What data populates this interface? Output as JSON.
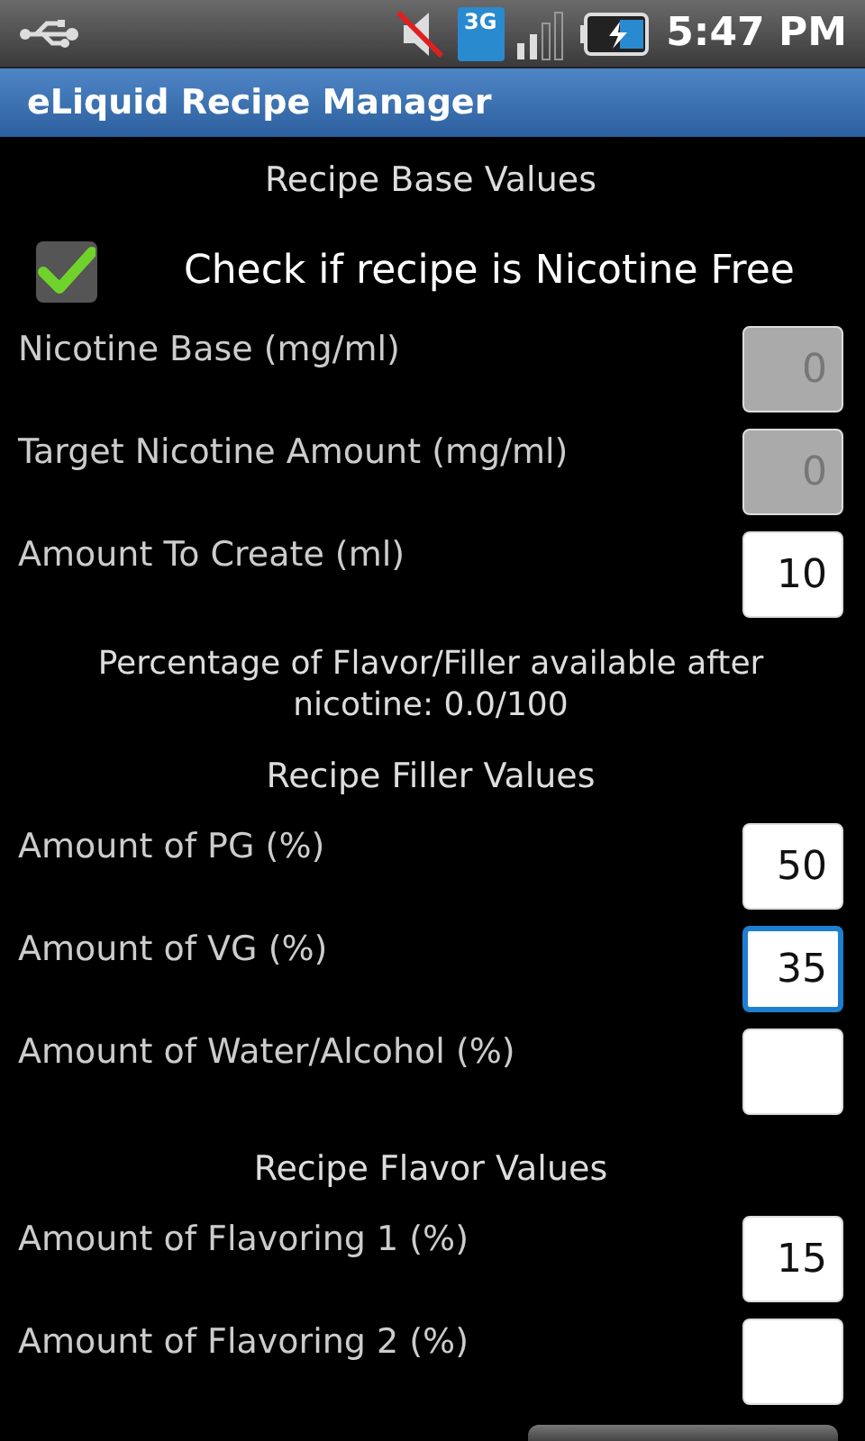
{
  "status_bar": {
    "network": "3G",
    "time": "5:47 PM"
  },
  "title": "eLiquid Recipe Manager",
  "sections": [
    {
      "kind": "heading",
      "text": "Recipe Base Values"
    },
    {
      "kind": "checkbox",
      "label": "Check if recipe is Nicotine Free",
      "checked": true
    },
    {
      "kind": "field",
      "label": "Nicotine Base (mg/ml)",
      "value": "0",
      "disabled": true,
      "focused": false
    },
    {
      "kind": "field",
      "label": "Target Nicotine Amount (mg/ml)",
      "value": "0",
      "disabled": true,
      "focused": false
    },
    {
      "kind": "field",
      "label": "Amount To Create (ml)",
      "value": "10",
      "disabled": false,
      "focused": false
    },
    {
      "kind": "note",
      "text": "Percentage of Flavor/Filler available after nicotine: 0.0/100"
    },
    {
      "kind": "heading",
      "text": "Recipe Filler Values"
    },
    {
      "kind": "field",
      "label": "Amount of PG (%)",
      "value": "50",
      "disabled": false,
      "focused": false
    },
    {
      "kind": "field",
      "label": "Amount of VG (%)",
      "value": "35",
      "disabled": false,
      "focused": true
    },
    {
      "kind": "field",
      "label": "Amount of Water/Alcohol (%)",
      "disabled": false,
      "focused": false
    },
    {
      "kind": "heading",
      "text": "Recipe Flavor Values"
    },
    {
      "kind": "field",
      "label": "Amount of Flavoring 1 (%)",
      "value": "15",
      "disabled": false,
      "focused": false
    },
    {
      "kind": "field",
      "label": "Amount of Flavoring 2 (%)",
      "disabled": false,
      "focused": false
    }
  ]
}
